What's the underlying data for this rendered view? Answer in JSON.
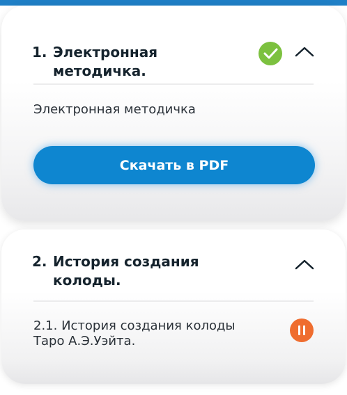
{
  "modules": [
    {
      "number": "1.",
      "title": "Электронная методичка.",
      "status_icon": "check-icon",
      "expanded_icon": "chevron-up-icon",
      "description": "Электронная методичка",
      "button_label": "Скачать в PDF"
    },
    {
      "number": "2.",
      "title": "История создания колоды.",
      "expanded_icon": "chevron-up-icon",
      "lessons": [
        {
          "label": "2.1. История создания колоды Таро А.Э.Уэйта.",
          "status_icon": "pause-icon"
        }
      ]
    }
  ],
  "colors": {
    "header_blue": "#1f7fc6",
    "button_blue": "#0e86d0",
    "check_green": "#7cc13f",
    "pause_orange": "#ef6d2f"
  }
}
